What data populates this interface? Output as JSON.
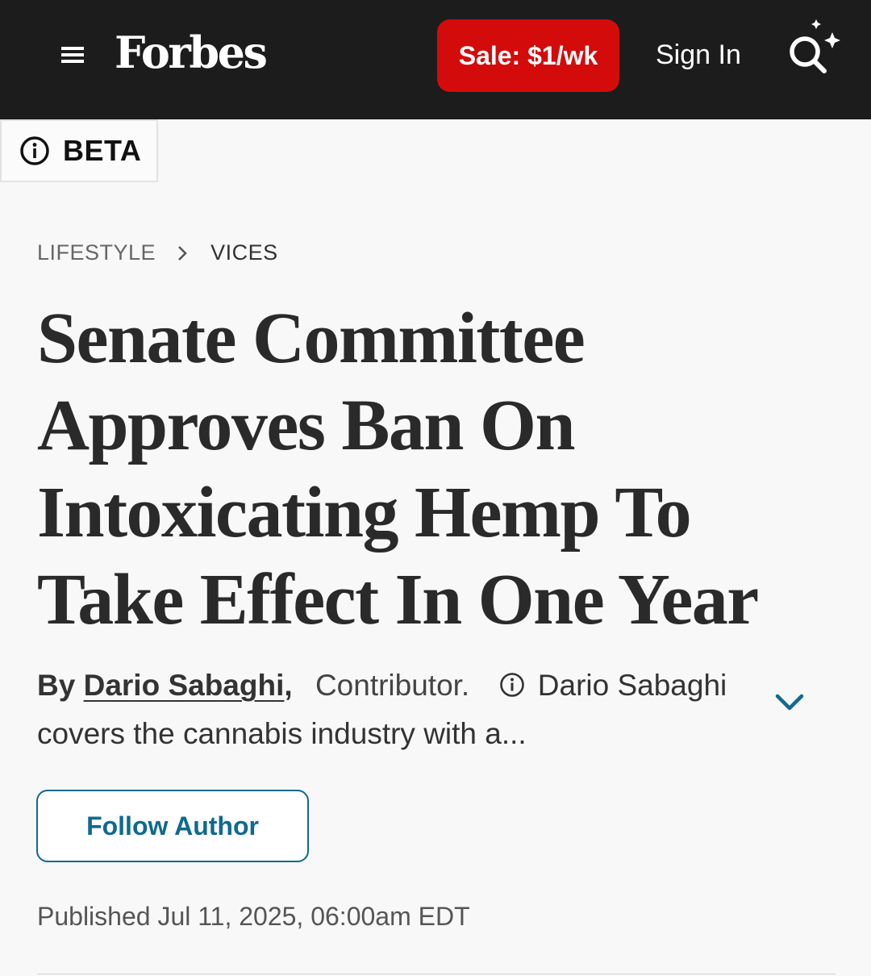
{
  "header": {
    "logo": "Forbes",
    "sale_label": "Sale: $1/wk",
    "sign_in_label": "Sign In",
    "bg_color": "#1c1c1c",
    "sale_color": "#d40b0b"
  },
  "beta": {
    "label": "BETA"
  },
  "breadcrumb": {
    "items": [
      "LIFESTYLE",
      "VICES"
    ]
  },
  "article": {
    "headline": "Senate Committee Approves Ban On Intoxicating Hemp To Take Effect In One Year",
    "byline": {
      "by": "By",
      "author": "Dario Sabaghi",
      "comma": ",",
      "role": "Contributor.",
      "bio": "Dario Sabaghi covers the cannabis industry with a..."
    },
    "follow_label": "Follow Author",
    "published": "Published Jul 11, 2025, 06:00am EDT"
  },
  "colors": {
    "accent": "#0f6a8e"
  }
}
